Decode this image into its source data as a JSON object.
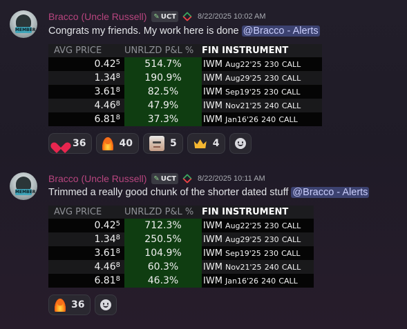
{
  "messages": [
    {
      "username": "Bracco (Uncle Russell)",
      "tag": "UCT",
      "timestamp": "8/22/2025 10:02 AM",
      "text": "Congrats my friends. My work here is done",
      "mention": "@Bracco - Alerts",
      "table": {
        "headers": [
          "AVG PRICE",
          "UNRLZD P&L %",
          "FIN INSTRUMENT"
        ],
        "rows": [
          {
            "avg_main": "0.42",
            "avg_sup": "5",
            "pnl": "514.7%",
            "sym": "IWM",
            "exp": "Aug22'25",
            "strike": "230",
            "type": "CALL"
          },
          {
            "avg_main": "1.34",
            "avg_sup": "8",
            "pnl": "190.9%",
            "sym": "IWM",
            "exp": "Aug29'25",
            "strike": "230",
            "type": "CALL"
          },
          {
            "avg_main": "3.61",
            "avg_sup": "8",
            "pnl": "82.5%",
            "sym": "IWM",
            "exp": "Sep19'25",
            "strike": "230",
            "type": "CALL"
          },
          {
            "avg_main": "4.46",
            "avg_sup": "8",
            "pnl": "47.9%",
            "sym": "IWM",
            "exp": "Nov21'25",
            "strike": "240",
            "type": "CALL"
          },
          {
            "avg_main": "6.81",
            "avg_sup": "8",
            "pnl": "37.3%",
            "sym": "IWM",
            "exp": "Jan16'26",
            "strike": "240",
            "type": "CALL"
          }
        ]
      },
      "reactions": [
        {
          "emoji": "heart",
          "count": "36"
        },
        {
          "emoji": "fire",
          "count": "40"
        },
        {
          "emoji": "face",
          "count": "5"
        },
        {
          "emoji": "crown",
          "count": "4"
        }
      ]
    },
    {
      "username": "Bracco (Uncle Russell)",
      "tag": "UCT",
      "timestamp": "8/22/2025 10:11 AM",
      "text": "Trimmed a really good chunk of the shorter dated stuff",
      "mention": "@Bracco - Alerts",
      "table": {
        "headers": [
          "AVG PRICE",
          "UNRLZD P&L %",
          "FIN INSTRUMENT"
        ],
        "rows": [
          {
            "avg_main": "0.42",
            "avg_sup": "5",
            "pnl": "712.3%",
            "sym": "IWM",
            "exp": "Aug22'25",
            "strike": "230",
            "type": "CALL"
          },
          {
            "avg_main": "1.34",
            "avg_sup": "8",
            "pnl": "250.5%",
            "sym": "IWM",
            "exp": "Aug29'25",
            "strike": "230",
            "type": "CALL"
          },
          {
            "avg_main": "3.61",
            "avg_sup": "8",
            "pnl": "104.9%",
            "sym": "IWM",
            "exp": "Sep19'25",
            "strike": "230",
            "type": "CALL"
          },
          {
            "avg_main": "4.46",
            "avg_sup": "8",
            "pnl": "60.3%",
            "sym": "IWM",
            "exp": "Nov21'25",
            "strike": "240",
            "type": "CALL"
          },
          {
            "avg_main": "6.81",
            "avg_sup": "8",
            "pnl": "46.3%",
            "sym": "IWM",
            "exp": "Jan16'26",
            "strike": "240",
            "type": "CALL"
          }
        ]
      },
      "reactions": [
        {
          "emoji": "fire",
          "count": "36"
        }
      ]
    }
  ],
  "icons": {
    "avatar_badge_text": "MEMBER",
    "tag_icon": "swords-icon",
    "status_icon": "diamond-icon",
    "add_reaction_icon": "smile-icon"
  },
  "colors": {
    "username": "#b8457f",
    "mention_bg": "#3c4270",
    "pnl_bg": "#0f3d11"
  }
}
